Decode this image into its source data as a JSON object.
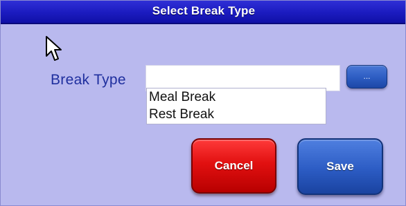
{
  "dialog": {
    "title": "Select Break Type"
  },
  "field": {
    "label": "Break Type",
    "value": "",
    "browse_label": "..."
  },
  "dropdown": {
    "options": [
      "Meal Break",
      "Rest Break"
    ]
  },
  "buttons": {
    "cancel": "Cancel",
    "save": "Save"
  },
  "colors": {
    "background": "#b9b9ee",
    "titlebar": "#1b1bbf",
    "label": "#1f2f9e",
    "cancel": "#e11010",
    "save": "#2c5cc4"
  },
  "icons": {
    "cursor": "pointer-cursor-icon"
  }
}
